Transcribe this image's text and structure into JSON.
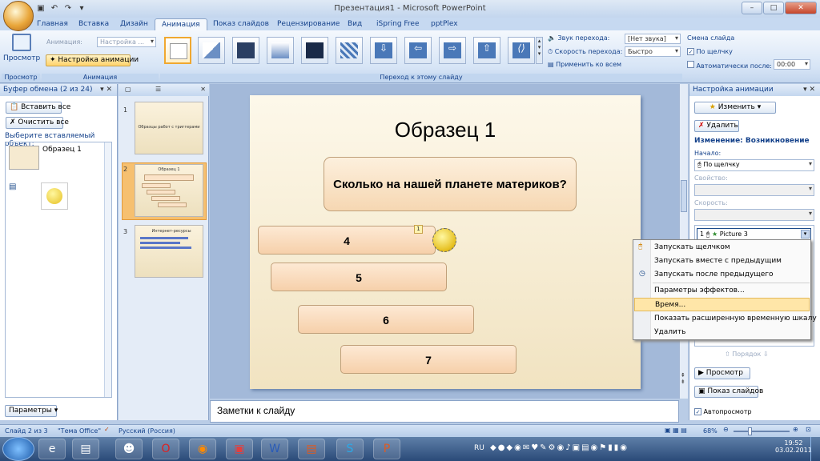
{
  "window": {
    "title": "Презентация1 - Microsoft PowerPoint"
  },
  "tabs": [
    "Главная",
    "Вставка",
    "Дизайн",
    "Анимация",
    "Показ слайдов",
    "Рецензирование",
    "Вид",
    "iSpring Free",
    "pptPlex"
  ],
  "active_tab": "Анимация",
  "ribbon": {
    "preview_label": "Просмотр",
    "anim_label": "Анимация:",
    "anim_value": "Настройка ...",
    "custom_anim_button": "Настройка анимации",
    "group_preview": "Просмотр",
    "group_animation": "Анимация",
    "group_transition": "Переход к этому слайду",
    "sound_label": "Звук перехода:",
    "sound_value": "[Нет звука]",
    "speed_label": "Скорость перехода:",
    "speed_value": "Быстро",
    "apply_all": "Применить ко всем",
    "advance_title": "Смена слайда",
    "on_click": "По щелчку",
    "auto_after": "Автоматически после:",
    "auto_time": "00:00"
  },
  "clipboard": {
    "title": "Буфер обмена (2 из 24)",
    "paste_all": "Вставить все",
    "clear_all": "Очистить все",
    "prompt": "Выберите вставляемый объект:",
    "item1": "Образец 1",
    "params": "Параметры"
  },
  "thumbnails": [
    {
      "num": "1",
      "text": "Образцы работ с триггерами"
    },
    {
      "num": "2",
      "text": "Образец 1"
    },
    {
      "num": "3",
      "text": "Интернет-ресурсы"
    }
  ],
  "slide": {
    "title": "Образец 1",
    "question": "Сколько на нашей планете материков?",
    "answers": [
      "4",
      "5",
      "6",
      "7"
    ],
    "anim_tag": "1"
  },
  "notes": "Заметки к слайду",
  "anim_pane": {
    "title": "Настройка анимации",
    "change": "Изменить",
    "delete": "Удалить",
    "change_label": "Изменение: Возникновение",
    "start_label": "Начало:",
    "start_value": "По щелчку",
    "prop_label": "Свойство:",
    "speed_label": "Скорость:",
    "item_num": "1",
    "item_name": "Picture 3",
    "order": "Порядок",
    "play": "Просмотр",
    "slideshow": "Показ слайдов",
    "autopreview": "Автопросмотр"
  },
  "context_menu": [
    "Запускать щелчком",
    "Запускать вместе с предыдущим",
    "Запускать после предыдущего",
    "Параметры эффектов...",
    "Время...",
    "Показать расширенную временную шкалу",
    "Удалить"
  ],
  "status": {
    "slide": "Слайд 2 из 3",
    "theme": "\"Тема Office\"",
    "lang": "Русский (Россия)",
    "zoom": "68%"
  },
  "taskbar": {
    "lang": "RU",
    "time": "19:52",
    "date": "03.02.2011"
  }
}
